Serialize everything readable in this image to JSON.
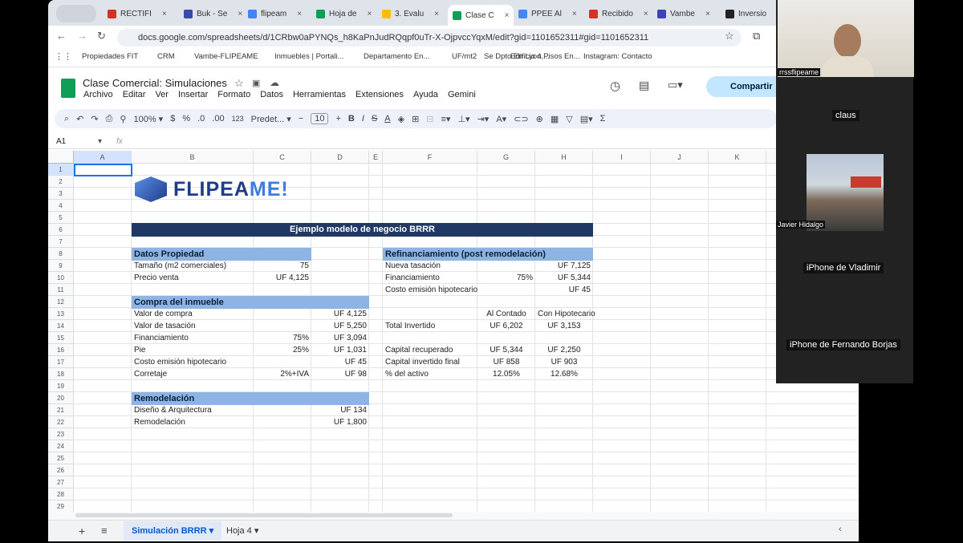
{
  "browser": {
    "tabs": [
      {
        "label": "RECTIFI",
        "color": "#d93025"
      },
      {
        "label": "Buk - Se",
        "color": "#3949ab"
      },
      {
        "label": "flipeam",
        "color": "#4285f4"
      },
      {
        "label": "Hoja de",
        "color": "#0f9d58"
      },
      {
        "label": "3. Evalu",
        "color": "#fbbc04"
      },
      {
        "label": "Clase C",
        "color": "#0f9d58"
      },
      {
        "label": "PPEE Al",
        "color": "#4285f4"
      },
      {
        "label": "Recibido",
        "color": "#d93025"
      },
      {
        "label": "Vambe",
        "color": "#3f3fbf"
      },
      {
        "label": "Inversio",
        "color": "#222"
      }
    ],
    "url": "docs.google.com/spreadsheets/d/1CRbw0aPYNQs_h8KaPnJudRQqpf0uTr-X-OjpvccYqxM/edit?gid=1101652311#gid=1101652311",
    "bookmarks": [
      "Propiedades FIT",
      "CRM",
      "Vambe-FLIPEAME",
      "Inmuebles | Portali...",
      "Departamento En...",
      "UF/mt2",
      "Se Dpto En Lyon,...",
      "Edificio 4 Pisos En...",
      "Instagram: Contacto"
    ]
  },
  "sheets": {
    "title": "Clase Comercial: Simulaciones",
    "menus": [
      "Archivo",
      "Editar",
      "Ver",
      "Insertar",
      "Formato",
      "Datos",
      "Herramientas",
      "Extensiones",
      "Ayuda",
      "Gemini"
    ],
    "share": "Compartir",
    "zoom": "100%",
    "font": "Predet...",
    "font_size": "10",
    "cell_ref": "A1",
    "fx": "fx",
    "columns": [
      "A",
      "B",
      "C",
      "D",
      "E",
      "F",
      "G",
      "H",
      "I",
      "J",
      "K"
    ],
    "rows": [
      "1",
      "2",
      "3",
      "4",
      "5",
      "6",
      "7",
      "8",
      "9",
      "10",
      "11",
      "12",
      "13",
      "14",
      "15",
      "16",
      "17",
      "18",
      "19",
      "20",
      "21",
      "22",
      "23",
      "24",
      "25",
      "26",
      "27",
      "28",
      "29"
    ],
    "logo": "FLIPEAME!",
    "cells": {
      "B6": "Ejemplo modelo de negocio BRRR",
      "B8": "Datos Propiedad",
      "B9": "Tamaño (m2 comerciales)",
      "C9": "75",
      "B10": "Precio venta",
      "C10": "UF 4,125",
      "B12": "Compra del inmueble",
      "B13": "Valor de compra",
      "D13": "UF 4,125",
      "B14": "Valor de tasación",
      "D14": "UF 5,250",
      "B15": "Financiamiento",
      "C15": "75%",
      "D15": "UF 3,094",
      "B16": "Pie",
      "C16": "25%",
      "D16": "UF 1,031",
      "B17": "Costo emisión hipotecario",
      "D17": "UF 45",
      "B18": "Corretaje",
      "C18": "2%+IVA",
      "D18": "UF 98",
      "B20": "Remodelación",
      "B21": "Diseño & Arquitectura",
      "D21": "UF 134",
      "B22": "Remodelación",
      "D22": "UF 1,800",
      "F8": "Refinanciamiento (post remodelación)",
      "F9": "Nueva tasación",
      "H9": "UF 7,125",
      "F10": "Financiamiento",
      "G10": "75%",
      "H10": "UF 5,344",
      "F11": "Costo emisión hipotecario",
      "H11": "UF 45",
      "G13": "Al Contado",
      "H13": "Con Hipotecario",
      "F14": "Total Invertido",
      "G14": "UF 6,202",
      "H14": "UF 3,153",
      "F16": "Capital recuperado",
      "G16": "UF 5,344",
      "H16": "UF 2,250",
      "F17": "Capital invertido final",
      "G17": "UF 858",
      "H17": "UF 903",
      "F18": "% del activo",
      "G18": "12.05%",
      "H18": "12.68%"
    },
    "sheet_tabs": [
      "Simulación BRRR",
      "Hoja 4"
    ]
  },
  "meeting": {
    "participants": [
      "rrssflipeame",
      "claus",
      "Javier Hidalgo",
      "iPhone de Vladimir",
      "iPhone de Fernando Borjas"
    ]
  }
}
